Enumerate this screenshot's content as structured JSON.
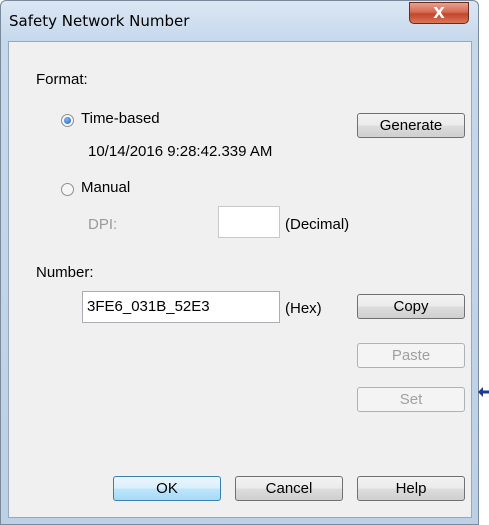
{
  "window": {
    "title": "Safety Network Number",
    "close_label": "X"
  },
  "format": {
    "label": "Format:",
    "time_based": {
      "label": "Time-based",
      "selected": true,
      "timestamp": "10/14/2016 9:28:42.339 AM"
    },
    "generate_label": "Generate",
    "manual": {
      "label": "Manual",
      "selected": false
    },
    "dpi": {
      "label": "DPI:",
      "value": "",
      "unit": "(Decimal)"
    }
  },
  "number": {
    "label": "Number:",
    "value": "3FE6_031B_52E3",
    "unit": "(Hex)"
  },
  "buttons": {
    "copy": "Copy",
    "paste": "Paste",
    "set": "Set",
    "ok": "OK",
    "cancel": "Cancel",
    "help": "Help"
  },
  "colors": {
    "accent": "#1b5fb0",
    "arrow": "#1f3a93"
  }
}
